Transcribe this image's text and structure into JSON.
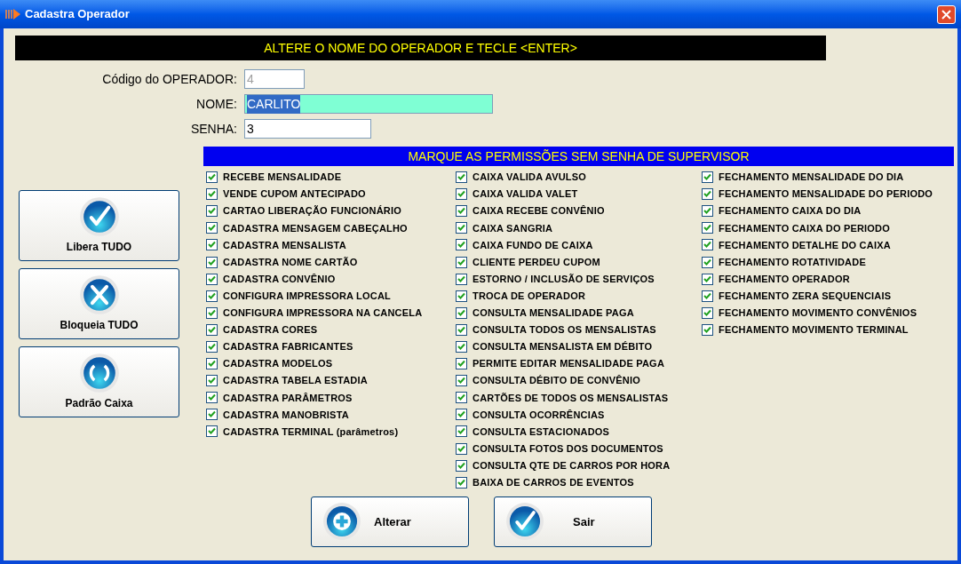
{
  "window": {
    "title": "Cadastra Operador"
  },
  "banner": "ALTERE O NOME DO OPERADOR E TECLE <ENTER>",
  "form": [
    {
      "label": "Código do OPERADOR:",
      "value": "4",
      "disabled": true,
      "highlighted": false
    },
    {
      "label": "NOME:",
      "value": "CARLITO",
      "disabled": false,
      "highlighted": true
    },
    {
      "label": "SENHA:",
      "value": "3",
      "disabled": false,
      "highlighted": false
    }
  ],
  "side_buttons": [
    {
      "label": "Libera TUDO"
    },
    {
      "label": "Bloqueia TUDO"
    },
    {
      "label": "Padrão Caixa"
    }
  ],
  "permissions": {
    "title": "MARQUE AS PERMISSÕES SEM SENHA DE SUPERVISOR",
    "columns": [
      [
        {
          "label": "RECEBE MENSALIDADE",
          "checked": true
        },
        {
          "label": "VENDE CUPOM ANTECIPADO",
          "checked": true
        },
        {
          "label": "CARTAO LIBERAÇÃO FUNCIONÁRIO",
          "checked": true
        },
        {
          "label": "CADASTRA MENSAGEM CABEÇALHO",
          "checked": true
        },
        {
          "label": "CADASTRA MENSALISTA",
          "checked": true
        },
        {
          "label": "CADASTRA NOME CARTÃO",
          "checked": true
        },
        {
          "label": "CADASTRA CONVÊNIO",
          "checked": true
        },
        {
          "label": "CONFIGURA IMPRESSORA LOCAL",
          "checked": true
        },
        {
          "label": "CONFIGURA IMPRESSORA NA CANCELA",
          "checked": true
        },
        {
          "label": "CADASTRA CORES",
          "checked": true
        },
        {
          "label": "CADASTRA FABRICANTES",
          "checked": true
        },
        {
          "label": "CADASTRA MODELOS",
          "checked": true
        },
        {
          "label": "CADASTRA TABELA ESTADIA",
          "checked": true
        },
        {
          "label": "CADASTRA PARÂMETROS",
          "checked": true
        },
        {
          "label": "CADASTRA MANOBRISTA",
          "checked": true
        },
        {
          "label": "CADASTRA TERMINAL (parâmetros)",
          "checked": true
        }
      ],
      [
        {
          "label": "CAIXA VALIDA AVULSO",
          "checked": true
        },
        {
          "label": "CAIXA VALIDA VALET",
          "checked": true
        },
        {
          "label": "CAIXA RECEBE CONVÊNIO",
          "checked": true
        },
        {
          "label": "CAIXA SANGRIA",
          "checked": true
        },
        {
          "label": "CAIXA FUNDO DE CAIXA",
          "checked": true
        },
        {
          "label": "CLIENTE PERDEU CUPOM",
          "checked": true
        },
        {
          "label": "ESTORNO / INCLUSÃO DE SERVIÇOS",
          "checked": true
        },
        {
          "label": "TROCA DE OPERADOR",
          "checked": true
        },
        {
          "label": "CONSULTA MENSALIDADE PAGA",
          "checked": true
        },
        {
          "label": "CONSULTA TODOS OS MENSALISTAS",
          "checked": true
        },
        {
          "label": "CONSULTA MENSALISTA EM DÉBITO",
          "checked": true
        },
        {
          "label": "PERMITE EDITAR MENSALIDADE PAGA",
          "checked": true
        },
        {
          "label": "CONSULTA DÉBITO DE CONVÊNIO",
          "checked": true
        },
        {
          "label": "CARTÕES DE TODOS OS MENSALISTAS",
          "checked": true
        },
        {
          "label": "CONSULTA OCORRÊNCIAS",
          "checked": true
        },
        {
          "label": "CONSULTA ESTACIONADOS",
          "checked": true
        },
        {
          "label": "CONSULTA FOTOS DOS DOCUMENTOS",
          "checked": true
        },
        {
          "label": "CONSULTA QTE DE CARROS POR HORA",
          "checked": true
        },
        {
          "label": "BAIXA DE CARROS DE EVENTOS",
          "checked": true
        }
      ],
      [
        {
          "label": "FECHAMENTO MENSALIDADE DO DIA",
          "checked": true
        },
        {
          "label": "FECHAMENTO MENSALIDADE DO PERIODO",
          "checked": true
        },
        {
          "label": "FECHAMENTO CAIXA DO DIA",
          "checked": true
        },
        {
          "label": "FECHAMENTO CAIXA DO PERIODO",
          "checked": true
        },
        {
          "label": "FECHAMENTO DETALHE DO CAIXA",
          "checked": true
        },
        {
          "label": "FECHAMENTO ROTATIVIDADE",
          "checked": true
        },
        {
          "label": "FECHAMENTO OPERADOR",
          "checked": true
        },
        {
          "label": "FECHAMENTO ZERA SEQUENCIAIS",
          "checked": true
        },
        {
          "label": "FECHAMENTO MOVIMENTO CONVÊNIOS",
          "checked": true
        },
        {
          "label": "FECHAMENTO MOVIMENTO TERMINAL",
          "checked": true
        }
      ]
    ]
  },
  "bottom_buttons": [
    {
      "label": "Alterar"
    },
    {
      "label": "Sair"
    }
  ]
}
